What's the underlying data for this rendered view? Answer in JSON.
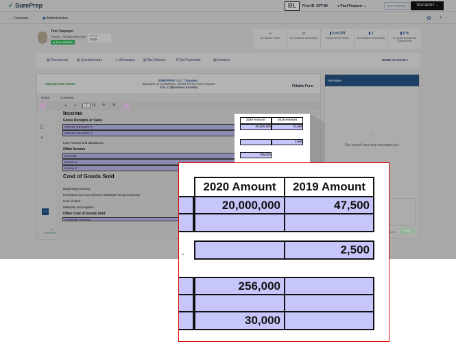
{
  "topbar": {
    "logo": "SurePrep",
    "badge": "BL",
    "firm": "Firm ID: SPT-80",
    "user": "Paul Preparer",
    "help": "HELP CENTER",
    "taxcaddy": "TAXCADDY"
  },
  "nav": {
    "overview": "Overview",
    "admin": "Administrative"
  },
  "client": {
    "name": "Tom Taxpayer",
    "phase": "PHASE - REVIEW AND FILE",
    "following": "FOLLOWING",
    "year_label": "Tax Year",
    "year": "2020"
  },
  "stats": [
    {
      "v": "",
      "l": "NO SMART LINKS"
    },
    {
      "v": "",
      "l": "NO UNREAD MESSAGES"
    },
    {
      "v": "0 of 229",
      "l": "REQUESTED ITEMS"
    },
    {
      "v": "1",
      "l": "DOCUMENT UPLOADED"
    },
    {
      "v": "0 %",
      "l": "OF QUESTIONNAIRE COMPLETED"
    }
  ],
  "tabs": [
    "Documents",
    "Questionnaire",
    "Messages",
    "Tax Returns",
    "Tax Payments",
    "Invoices"
  ],
  "more_actions": "MORE ACTIONS",
  "doc": {
    "back": "REQUESTED ITEMS",
    "file": "SUREPREP_LLC_Taxpayer_",
    "uploaded": "Uploaded on 11/08/2021 - 04:53 PM by Paul Preparer",
    "form": "Sch. C (Business Income)",
    "fillable": "Fillable Form",
    "tab_home": "Home",
    "tab_comment": "Comment",
    "page": "1",
    "pages": "/ 6",
    "download": "DOWNLOAD"
  },
  "form": {
    "income": "Income",
    "gross": "Gross Receipts or Sales",
    "gr1": "GROSS RECEIPT 1",
    "gr2": "GROSS RECEIPT 2",
    "returns": "Less Returns and allowances",
    "other_income": "Other Income",
    "inc": "INCOME",
    "inc1": "Income 1",
    "inc2": "Income 2",
    "cogs": "Cost of Goods Sold",
    "beg": "Beginning inventory",
    "purch": "Purchases less cost of items withdrawn for personal use",
    "labor": "Cost of labor",
    "mat": "Materials and supplies",
    "other_cogs": "Other Cost of Goods Sold",
    "cog": "COST OF GOODS",
    "h2020": "2020 Amount",
    "h2019": "2019 Amount",
    "gr1_2020": "20,000,000",
    "gr1_2019": "47,500",
    "ret_2019": "2,500",
    "inc_2020": "256,000",
    "cog_2020": "30,000"
  },
  "messages": {
    "title": "Messages",
    "empty": "You haven't sent any messages yet.",
    "count": "1000",
    "send": "SEND"
  }
}
